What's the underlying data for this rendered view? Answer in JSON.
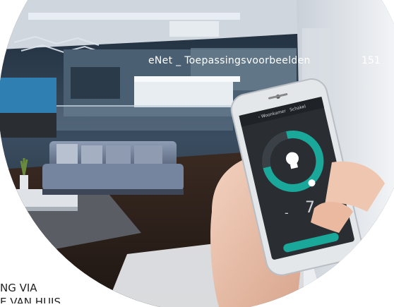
{
  "header": {
    "title": "eNet _ Toepassingsvoorbeelden",
    "page_number": "151"
  },
  "phone": {
    "back_label": "Woonkamer",
    "screen_title": "Schakel",
    "minus_label": "-",
    "value_label": "7",
    "dial_level_percent": 70,
    "accent_color": "#1aa89a"
  },
  "caption": {
    "line1": "NG VIA",
    "line2": "E VAN HUIS"
  }
}
